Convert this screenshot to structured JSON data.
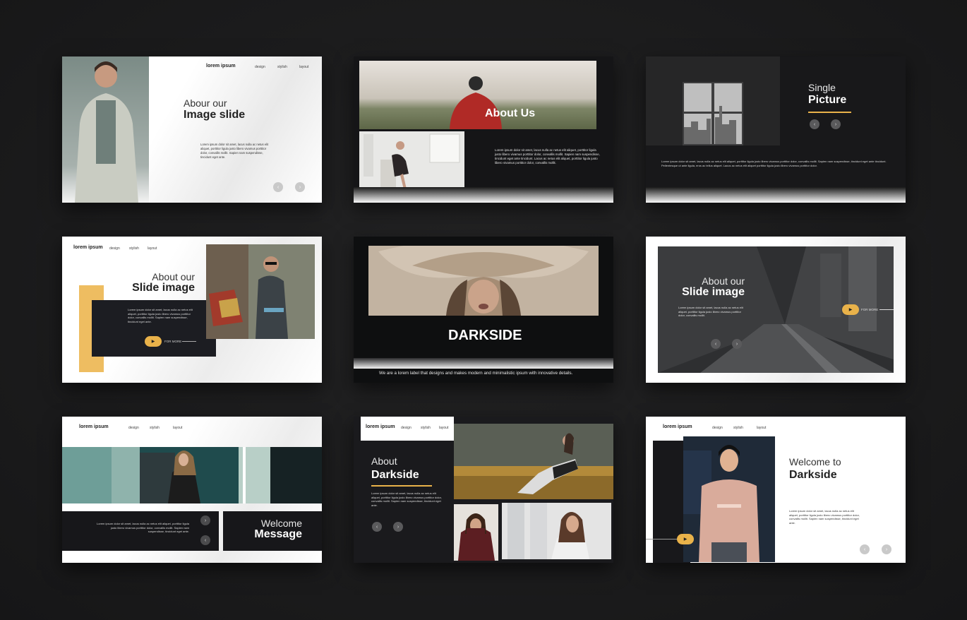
{
  "slides": {
    "s1": {
      "logo": "lorem ipsum",
      "nav": [
        "design",
        "stylish",
        "layout"
      ],
      "title_light": "Abour our",
      "title_bold": "Image slide",
      "body": "Lorem ipsum dolor sit amet, lacus nulla ac netus elit aliquet, porttitor ligula justo libero vivamus porttitor dolor, convallis mollit. Sapien nam suspendisse, tincidunt eget ante."
    },
    "s2": {
      "title": "About Us",
      "body": "Lorem ipsum dolor sit amet, lacus nulla ac netus elit aliquet, porttitor ligula justo libero vivamus porttitor dolor, convallis mollit. Sapien nam suspendisse, tincidunt eget ante tincidunt. Lacus ac netus elit aliquet, porttitor ligula justo libero vivamus porttitor dolor, convallis mollit."
    },
    "s3": {
      "title_light": "Single",
      "title_bold": "Picture",
      "body": "Lorem ipsum dolor sit amet, lacus nulla ac netus elit aliquet, porttitor ligula justo libero vivamus porttitor dolor, convallis mollit. Sapien nam suspendisse, tincidunt eget ante tincidunt. Pellentesque ut ante ligula, eros ac tellus aliquet. Lacus ac netus elit aliquet porttitor ligula justo libero vivamus porttitor dolor."
    },
    "s4": {
      "logo": "lorem ipsum",
      "nav": [
        "design",
        "stylish",
        "layout"
      ],
      "title_light": "About our",
      "title_bold": "Slide image",
      "body": "Lorem ipsum dolor sit amet, lacus nulla ac netus elit aliquet, porttitor ligula justo libero vivamus porttitor dolor, convallis mollit. Sapien nam suspendisse, tincidunt eget ante.",
      "more": "FOR MORE"
    },
    "s5": {
      "title": "DARKSIDE",
      "tagline": "We are a lorem label that  designs and makes modern and minimalistic ipsum with innovative details."
    },
    "s6": {
      "title_light": "About our",
      "title_bold": "Slide image",
      "body": "Lorem ipsum dolor sit amet, lacus nulla ac netus elit aliquet, porttitor ligula justo libero vivamus porttitor dolor, convallis mollit.",
      "more": "FOR MORE"
    },
    "s7": {
      "logo": "lorem ipsum",
      "nav": [
        "design",
        "stylish",
        "layout"
      ],
      "title_light": "Welcome",
      "title_bold": "Message",
      "body": "Lorem ipsum dolor sit amet, lacus nulla ac netus elit aliquet, porttitor ligula justo libero vivamus porttitor dolor, convallis mollit. Sapien nam suspendisse, tincidunt eget ante."
    },
    "s8": {
      "logo": "lorem ipsum",
      "nav": [
        "design",
        "stylish",
        "layout"
      ],
      "title_light": "About",
      "title_bold": "Darkside",
      "body": "Lorem ipsum dolor sit amet, lacus nulla ac netus elit aliquet, porttitor ligula justo libero vivamus porttitor dolor, convallis mollit. Sapien nam suspendisse, tincidunt eget ante."
    },
    "s9": {
      "logo": "lorem ipsum",
      "nav": [
        "design",
        "stylish",
        "layout"
      ],
      "title_light": "Welcome to",
      "title_bold": "Darkside",
      "body": "Lorem ipsum dolor sit amet, lacus nulla ac netus elit aliquet, porttitor ligula justo libero vivamus porttitor dolor, convallis mollit. Sapien nam suspendisse, tincidunt eget ante."
    }
  },
  "glyphs": {
    "prev": "‹",
    "next": "›",
    "play": "▶"
  },
  "colors": {
    "accent": "#e9b24a",
    "dark": "#1a1a1c",
    "light": "#f4f4f4"
  }
}
